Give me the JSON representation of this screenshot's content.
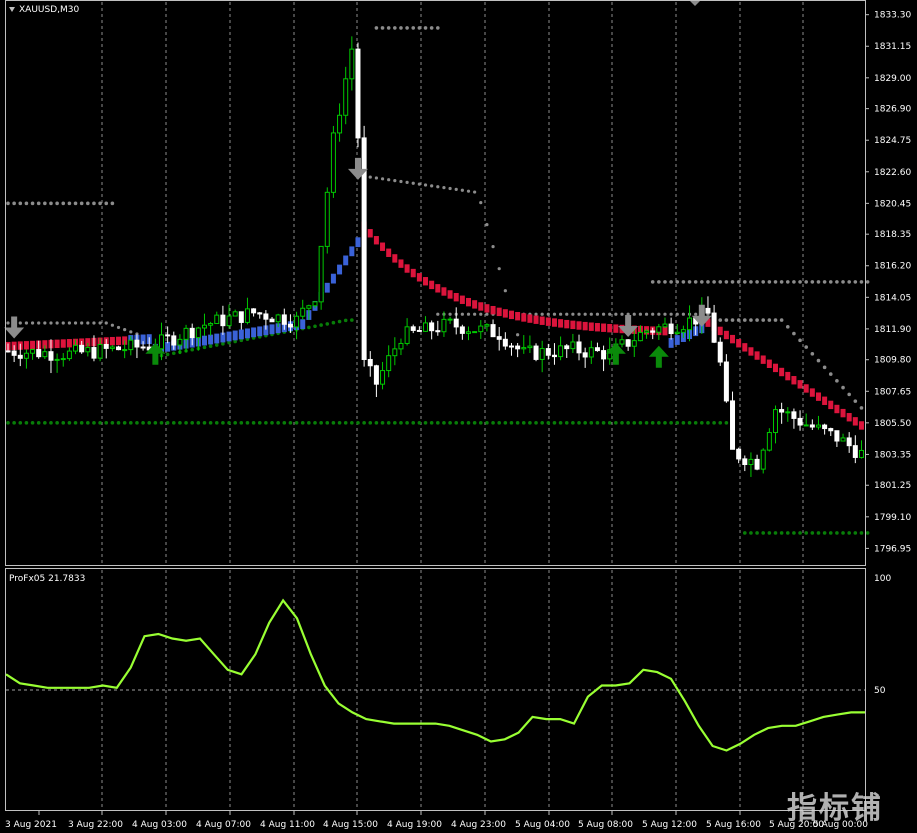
{
  "window": {
    "symbol_title": "XAUUSD,M30",
    "indicator_title": "ProFx05 21.7833",
    "watermark": "指标铺"
  },
  "colors": {
    "background": "#000000",
    "frame": "#c0c0c0",
    "grid": "#c8c8c8",
    "bull_candle": "#00c800",
    "bear_candle": "#ffffff",
    "line_up": "#3a62d8",
    "line_down": "#dc143c",
    "dots_gray": "#8c8c8c",
    "dots_green": "#087d08",
    "arrow_up": "#0a8a0a",
    "arrow_down": "#8c8c8c",
    "oscillator": "#99ff33"
  },
  "chart_data": [
    {
      "type": "candlestick",
      "title": "XAUUSD,M30",
      "ylim": [
        1795.75,
        1834.3
      ],
      "y_ticks": [
        "1833.30",
        "1831.15",
        "1829.00",
        "1826.90",
        "1824.75",
        "1822.60",
        "1820.45",
        "1818.35",
        "1816.20",
        "1814.05",
        "1811.90",
        "1809.80",
        "1807.65",
        "1805.50",
        "1803.35",
        "1801.25",
        "1799.10",
        "1796.95"
      ],
      "x_ticks": [
        "3 Aug 2021",
        "3 Aug 22:00",
        "4 Aug 03:00",
        "4 Aug 07:00",
        "4 Aug 11:00",
        "4 Aug 15:00",
        "4 Aug 19:00",
        "4 Aug 23:00",
        "5 Aug 04:00",
        "5 Aug 08:00",
        "5 Aug 12:00",
        "5 Aug 16:00",
        "5 Aug 20:00",
        "5 Aug 00:00"
      ],
      "x_ticks_partial": [
        false,
        false,
        false,
        false,
        false,
        false,
        false,
        false,
        false,
        false,
        false,
        false,
        true,
        true
      ],
      "grid": true,
      "levels": [
        {
          "kind": "gray-dots",
          "start": 0,
          "end": 17,
          "price": 1820.45
        },
        {
          "kind": "gray-dots",
          "start": 60,
          "end": 70,
          "price": 1832.4
        },
        {
          "kind": "green-dots",
          "start": 0,
          "end": 118,
          "price": 1805.5
        },
        {
          "kind": "gray-dots",
          "start": 105,
          "end": 140,
          "price": 1815.1
        },
        {
          "kind": "green-dots",
          "start": 120,
          "end": 140,
          "price": 1798.0
        }
      ]
    },
    {
      "type": "line",
      "title": "ProFx05 21.7833",
      "ylim": [
        0,
        100
      ],
      "y_ticks": [
        "100",
        "50"
      ],
      "level": 50,
      "values": [
        57,
        53,
        52,
        51,
        51,
        51,
        51,
        52,
        51,
        60,
        74,
        75,
        73,
        72,
        73,
        66,
        59,
        57,
        66,
        80,
        90,
        82,
        66,
        52,
        44,
        40,
        37,
        36,
        35,
        35,
        35,
        35,
        34,
        32,
        30,
        27,
        28,
        31,
        38,
        37,
        37,
        35,
        47,
        52,
        52,
        53,
        59,
        58,
        55,
        45,
        34,
        25,
        23,
        26,
        30,
        33,
        34,
        34,
        36,
        38,
        39,
        40,
        40
      ]
    }
  ]
}
